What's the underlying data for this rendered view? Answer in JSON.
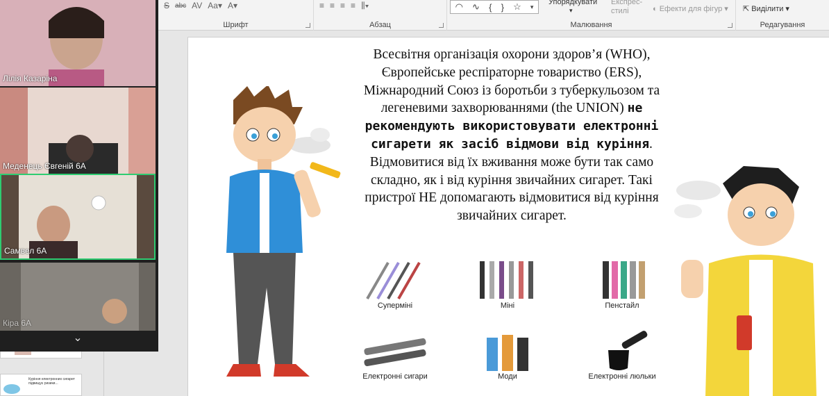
{
  "ribbon": {
    "groups": [
      {
        "label": "Шрифт"
      },
      {
        "label": "Абзац"
      },
      {
        "label": "Малювання"
      },
      {
        "label": "Редагування"
      }
    ],
    "arrange_label": "Упорядкувати",
    "quick_styles_label": "Експрес-стилі",
    "shape_effects_label": "Ефекти для фігур",
    "select_label": "Виділити"
  },
  "slide": {
    "text_part1": "Всесвітня організація охорони здоров’я (WHO), Європейське респіраторне товариство (ERS), Міжнародний Союз із боротьби з туберкульозом та легеневими захворюваннями (the UNION) ",
    "text_bold": "не рекомендують використовувати електронні сигарети як засіб відмови від куріння",
    "text_part2": ". Відмовитися від їх вживання може бути так само складно, як і від куріння звичайних сигарет. Такі пристрої НЕ допомагають відмовитися від куріння звичайних сигарет.",
    "devices": [
      {
        "label": "Суперміні"
      },
      {
        "label": "Міні"
      },
      {
        "label": "Пенстайл"
      },
      {
        "label": "Електронні сигари"
      },
      {
        "label": "Моди"
      },
      {
        "label": "Електронні люльки"
      }
    ]
  },
  "thumbnail": {
    "text": "Куріння електронних сигарет підвищує ризики..."
  },
  "video": {
    "participants": [
      {
        "name": "Лілія Казаріна"
      },
      {
        "name": "Меденець Євгеній 6А"
      },
      {
        "name": "Самвел 6А"
      },
      {
        "name": "Кіра 6А"
      }
    ],
    "expand_icon": "chevron-down-icon"
  },
  "colors": {
    "active_speaker": "#2ecc71",
    "ribbon_bg": "#f3f3f3"
  }
}
